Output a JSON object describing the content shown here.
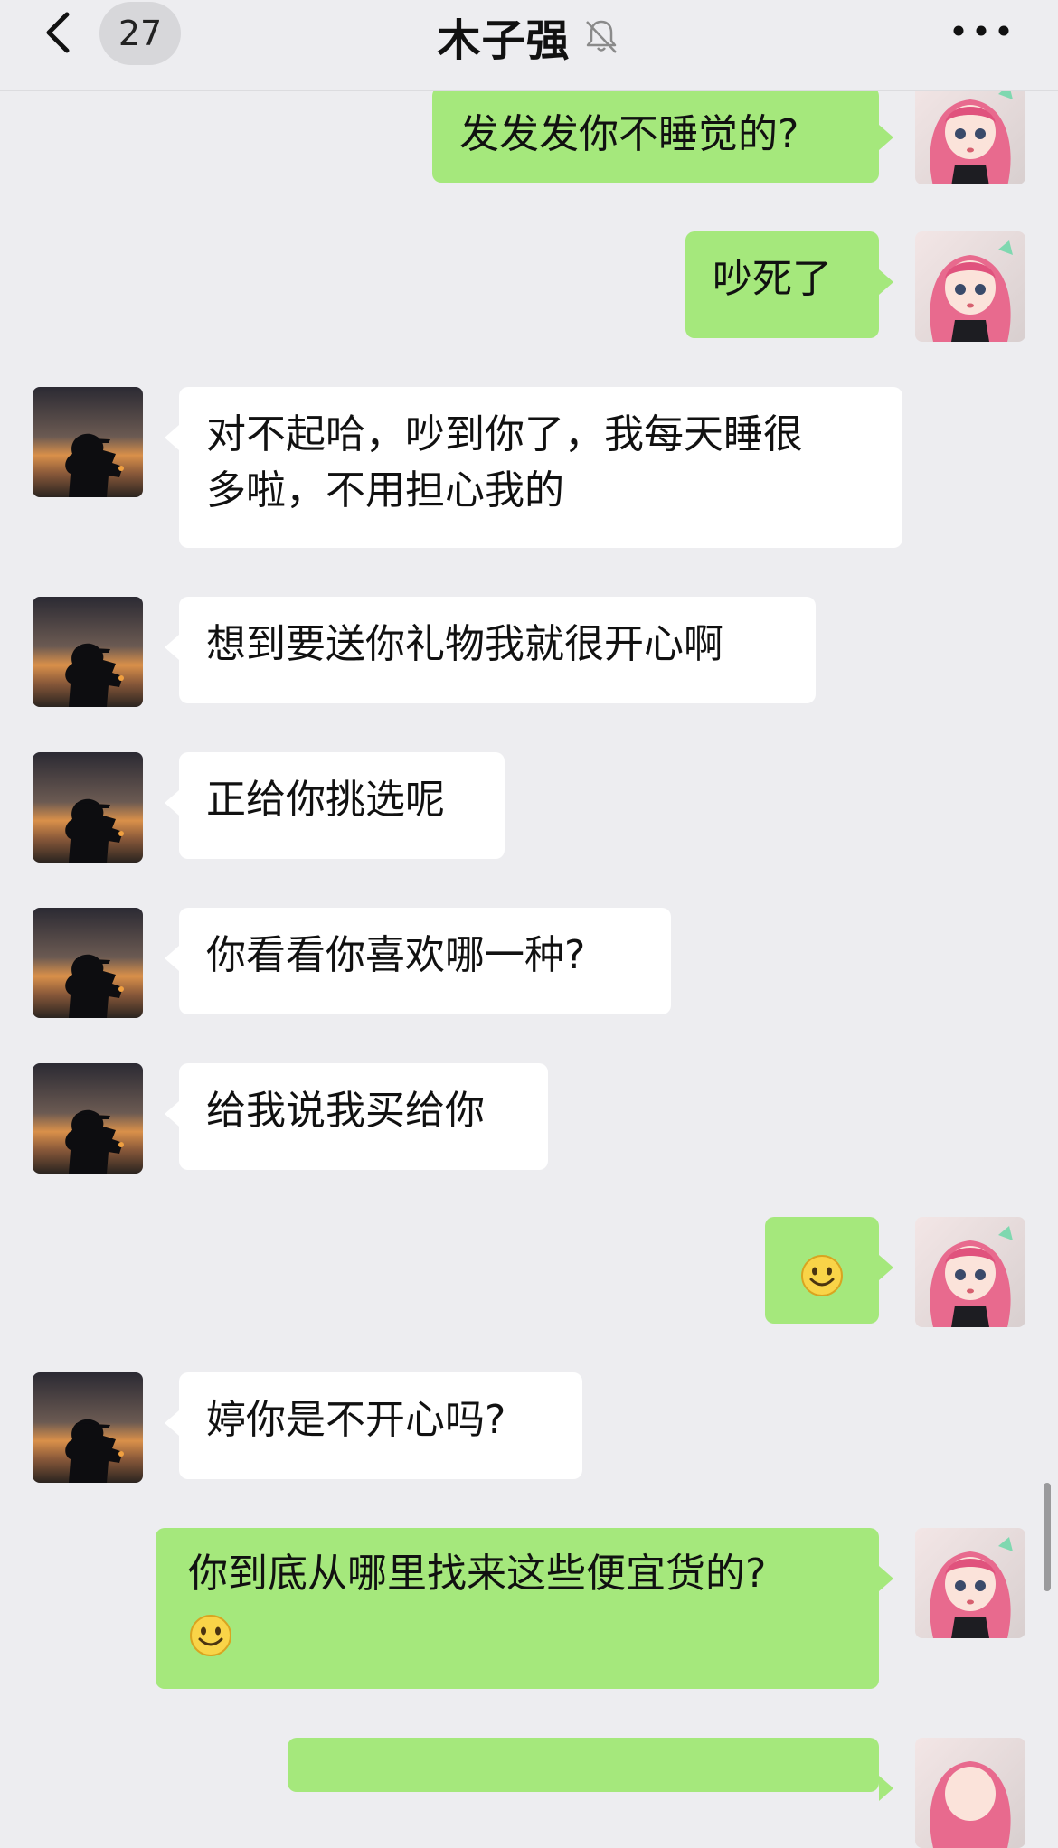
{
  "header": {
    "back_icon": "chevron-left-icon",
    "unread_count": "27",
    "title": "木子强",
    "mute_icon": "bell-muted-icon",
    "more_icon": "more-dots-icon"
  },
  "colors": {
    "background": "#ededf0",
    "sent_bubble": "#a5e87c",
    "received_bubble": "#ffffff"
  },
  "messages": [
    {
      "side": "right",
      "text": "发发发你不睡觉的?"
    },
    {
      "side": "right",
      "text": "吵死了"
    },
    {
      "side": "left",
      "line1": "对不起哈，吵到你了，我每天睡很",
      "line2": "多啦，不用担心我的"
    },
    {
      "side": "left",
      "text": "想到要送你礼物我就很开心啊"
    },
    {
      "side": "left",
      "text": "正给你挑选呢"
    },
    {
      "side": "left",
      "text": "你看看你喜欢哪一种?"
    },
    {
      "side": "left",
      "text": "给我说我买给你"
    },
    {
      "side": "right",
      "emoji": "smile-emoji"
    },
    {
      "side": "left",
      "text": "婷你是不开心吗?"
    },
    {
      "side": "right",
      "text": "你到底从哪里找来这些便宜货的?",
      "emoji": "smile-emoji"
    },
    {
      "side": "right",
      "text": ""
    }
  ]
}
